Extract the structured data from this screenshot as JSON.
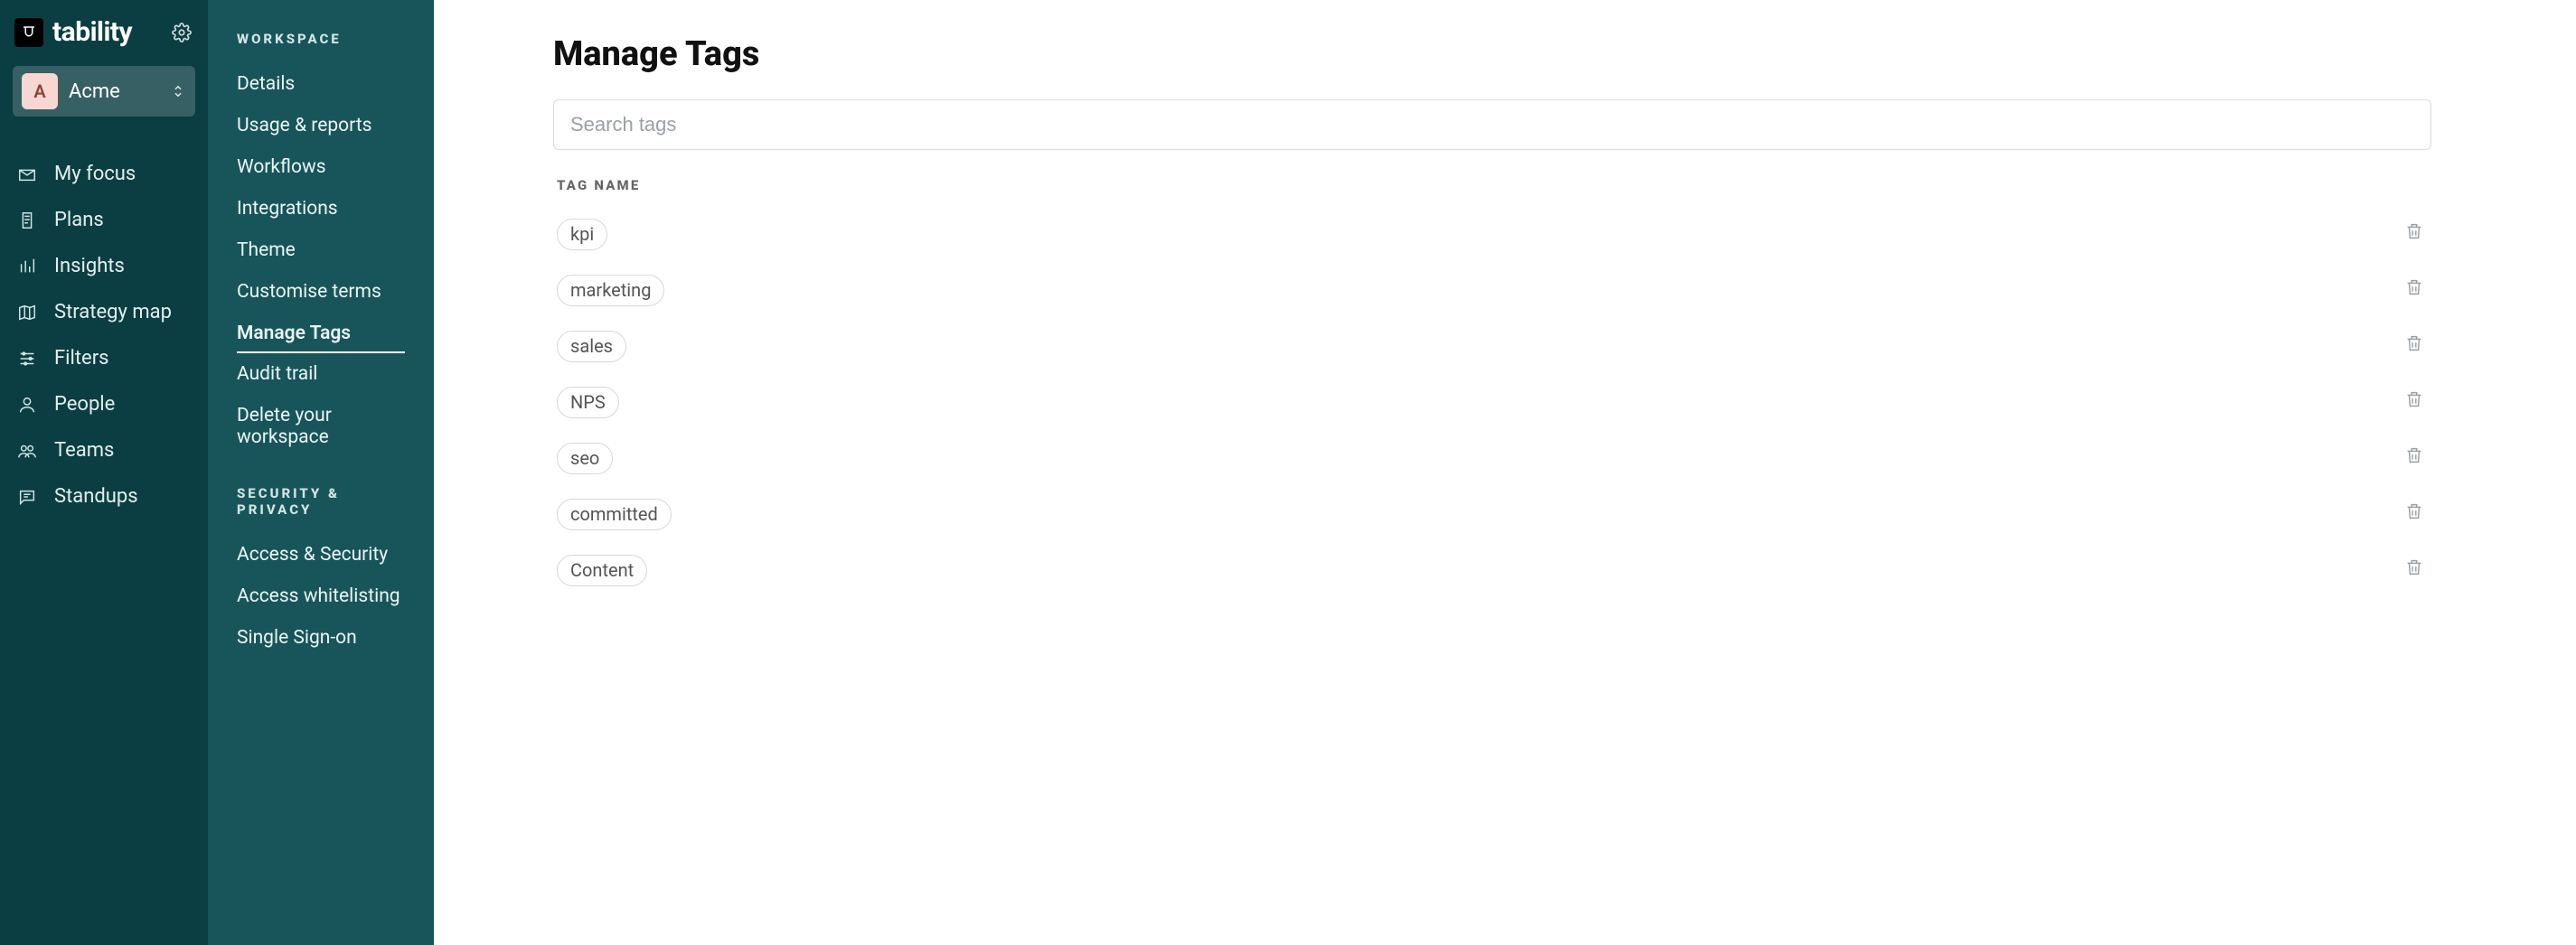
{
  "brand": {
    "name": "tability"
  },
  "workspace": {
    "initial": "A",
    "name": "Acme"
  },
  "primary_nav": {
    "items": [
      {
        "id": "my-focus",
        "label": "My focus"
      },
      {
        "id": "plans",
        "label": "Plans"
      },
      {
        "id": "insights",
        "label": "Insights"
      },
      {
        "id": "strategy-map",
        "label": "Strategy map"
      },
      {
        "id": "filters",
        "label": "Filters"
      },
      {
        "id": "people",
        "label": "People"
      },
      {
        "id": "teams",
        "label": "Teams"
      },
      {
        "id": "standups",
        "label": "Standups"
      }
    ]
  },
  "settings_nav": {
    "groups": [
      {
        "heading": "WORKSPACE",
        "items": [
          {
            "id": "details",
            "label": "Details"
          },
          {
            "id": "usage",
            "label": "Usage & reports"
          },
          {
            "id": "workflows",
            "label": "Workflows"
          },
          {
            "id": "integrations",
            "label": "Integrations"
          },
          {
            "id": "theme",
            "label": "Theme"
          },
          {
            "id": "terms",
            "label": "Customise terms"
          },
          {
            "id": "manage-tags",
            "label": "Manage Tags",
            "active": true
          },
          {
            "id": "audit",
            "label": "Audit trail"
          },
          {
            "id": "delete-ws",
            "label": "Delete your workspace"
          }
        ]
      },
      {
        "heading": "SECURITY & PRIVACY",
        "items": [
          {
            "id": "access-sec",
            "label": "Access & Security"
          },
          {
            "id": "whitelist",
            "label": "Access whitelisting"
          },
          {
            "id": "sso",
            "label": "Single Sign-on"
          }
        ]
      }
    ]
  },
  "page": {
    "title": "Manage Tags",
    "search_placeholder": "Search tags",
    "column_header": "TAG NAME",
    "tags": [
      {
        "name": "kpi"
      },
      {
        "name": "marketing"
      },
      {
        "name": "sales"
      },
      {
        "name": "NPS"
      },
      {
        "name": "seo"
      },
      {
        "name": "committed"
      },
      {
        "name": "Content"
      }
    ]
  }
}
